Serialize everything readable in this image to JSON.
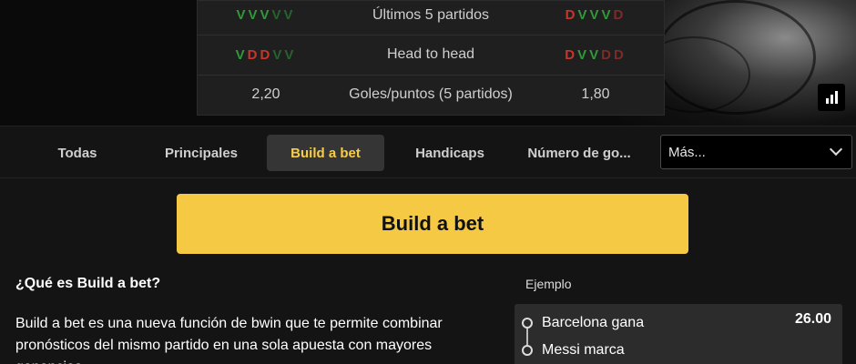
{
  "stats": {
    "rows": [
      {
        "home_form": [
          {
            "r": "V",
            "c": "v"
          },
          {
            "r": "V",
            "c": "v"
          },
          {
            "r": "V",
            "c": "v"
          },
          {
            "r": "V",
            "c": "v dim"
          },
          {
            "r": "V",
            "c": "v dim"
          }
        ],
        "label": "Últimos 5 partidos",
        "away_form": [
          {
            "r": "D",
            "c": "d"
          },
          {
            "r": "V",
            "c": "v"
          },
          {
            "r": "V",
            "c": "v"
          },
          {
            "r": "V",
            "c": "v"
          },
          {
            "r": "D",
            "c": "d dim"
          }
        ]
      },
      {
        "home_form": [
          {
            "r": "V",
            "c": "v"
          },
          {
            "r": "D",
            "c": "d"
          },
          {
            "r": "D",
            "c": "d"
          },
          {
            "r": "V",
            "c": "v dim"
          },
          {
            "r": "V",
            "c": "v dim"
          }
        ],
        "label": "Head to head",
        "away_form": [
          {
            "r": "D",
            "c": "d"
          },
          {
            "r": "V",
            "c": "v"
          },
          {
            "r": "V",
            "c": "v"
          },
          {
            "r": "D",
            "c": "d dim"
          },
          {
            "r": "D",
            "c": "d dim"
          }
        ]
      },
      {
        "home_value": "2,20",
        "label": "Goles/puntos (5 partidos)",
        "away_value": "1,80"
      }
    ]
  },
  "stats_button_icon": "bar-chart-icon",
  "tabs": {
    "items": [
      {
        "label": "Todas"
      },
      {
        "label": "Principales"
      },
      {
        "label": "Build a bet",
        "active": true
      },
      {
        "label": "Handicaps"
      },
      {
        "label": "Número de go..."
      }
    ],
    "more_label": "Más..."
  },
  "content": {
    "main_button": "Build a bet",
    "what_title": "¿Qué es Build a bet?",
    "what_text": "Build a bet es una nueva función de bwin que te permite combinar pronósticos del mismo partido en una sola apuesta con mayores ganancias.",
    "example_label": "Ejemplo",
    "example_items": [
      "Barcelona gana",
      "Messi marca"
    ],
    "example_odds": "26.00"
  },
  "colors": {
    "accent": "#f6c944",
    "win": "#2e9a3a",
    "loss": "#c8352c",
    "background": "#141414"
  }
}
